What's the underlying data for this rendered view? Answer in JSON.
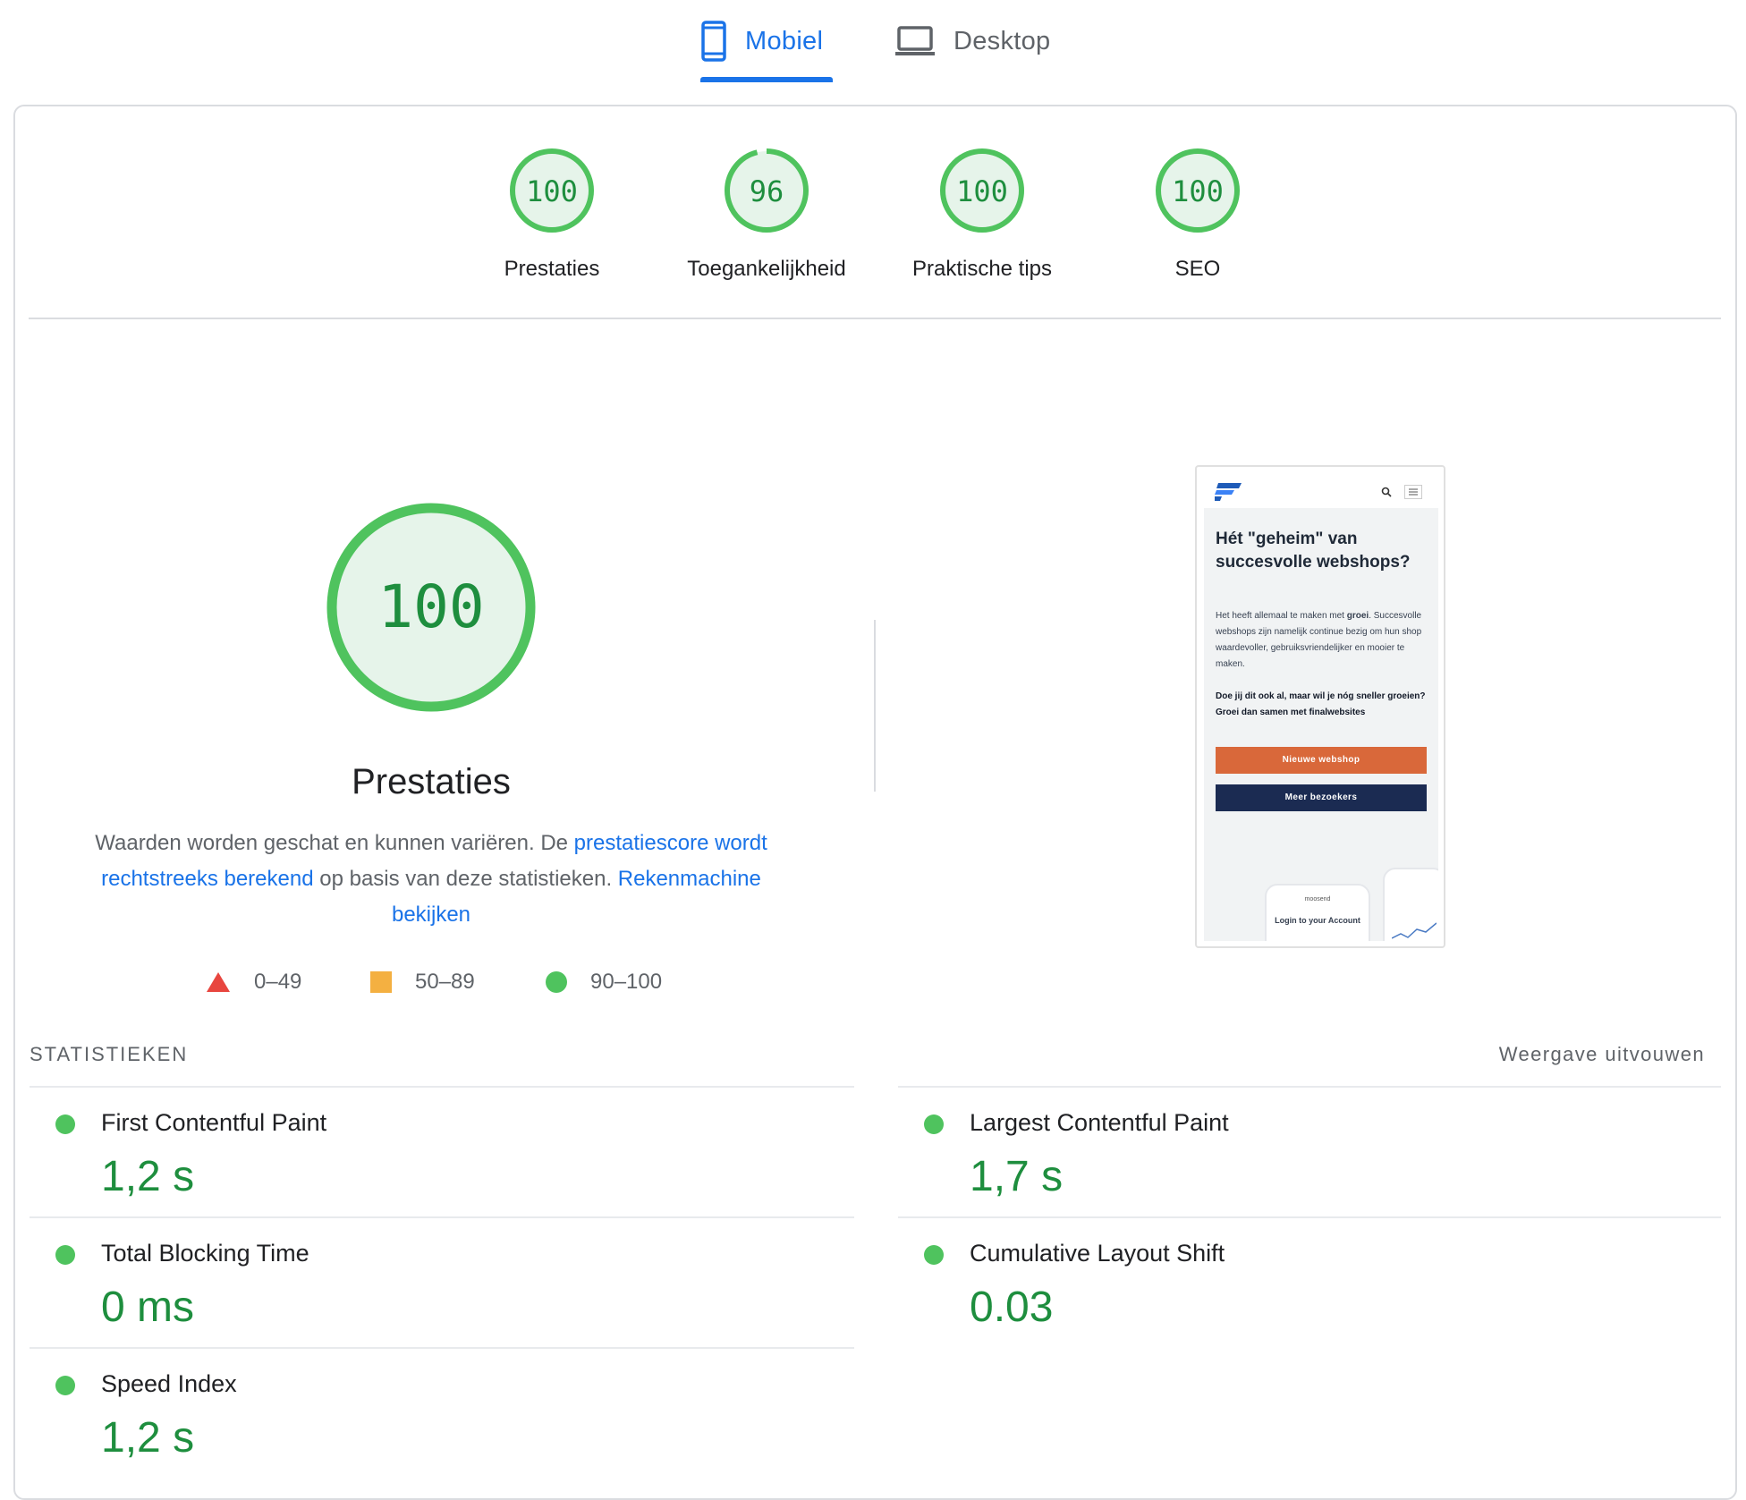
{
  "tabs": {
    "mobile_label": "Mobiel",
    "desktop_label": "Desktop",
    "active": "mobile",
    "active_color": "#1a73e8"
  },
  "scores": [
    {
      "score": "100",
      "label": "Prestaties",
      "fraction": 1.0
    },
    {
      "score": "96",
      "label": "Toegankelijkheid",
      "fraction": 0.96
    },
    {
      "score": "100",
      "label": "Praktische tips",
      "fraction": 1.0
    },
    {
      "score": "100",
      "label": "SEO",
      "fraction": 1.0
    }
  ],
  "main": {
    "score": "100",
    "title": "Prestaties",
    "desc_prefix": "Waarden worden geschat en kunnen variëren. De ",
    "desc_link1": "prestatiescore wordt rechtstreeks berekend",
    "desc_middle": " op basis van deze statistieken. ",
    "desc_link2": "Rekenmachine bekijken"
  },
  "legend": [
    {
      "range": "0–49",
      "shape": "triangle",
      "color": "#e8463f"
    },
    {
      "range": "50–89",
      "shape": "square",
      "color": "#f4b041"
    },
    {
      "range": "90–100",
      "shape": "circle",
      "color": "#4fc35e"
    }
  ],
  "screenshot": {
    "title": "Hét \"geheim\" van succesvolle webshops?",
    "p1_start": "Het heeft allemaal te maken met ",
    "p1_bold": "groei",
    "p1_end": ". Succesvolle webshops zijn namelijk continue bezig om hun shop waardevoller, gebruiksvriendelijker en mooier te maken.",
    "p2": "Doe jij dit ook al, maar wil je nóg sneller groeien? Groei dan samen met finalwebsites",
    "btn1": "Nieuwe webshop",
    "btn2": "Meer bezoekers",
    "phone_brand": "moosend",
    "phone_text": "Login to your Account"
  },
  "stats": {
    "title": "STATISTIEKEN",
    "expand": "Weergave uitvouwen",
    "metrics": [
      {
        "label": "First Contentful Paint",
        "value": "1,2 s"
      },
      {
        "label": "Largest Contentful Paint",
        "value": "1,7 s"
      },
      {
        "label": "Total Blocking Time",
        "value": "0 ms"
      },
      {
        "label": "Cumulative Layout Shift",
        "value": "0.03"
      },
      {
        "label": "Speed Index",
        "value": "1,2 s"
      }
    ]
  },
  "colors": {
    "pass": "#0cce6b",
    "pass_ring": "#4fc35e",
    "pass_fill": "#e6f4ea",
    "pass_text": "#1e8e3e",
    "link": "#1a73e8"
  }
}
